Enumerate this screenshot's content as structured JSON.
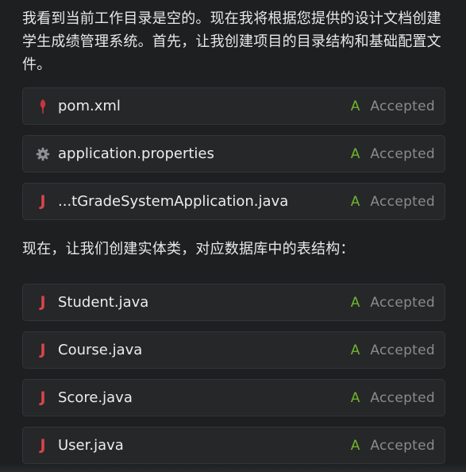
{
  "messages": {
    "intro": "我看到当前工作目录是空的。现在我将根据您提供的设计文档创建学生成绩管理系统。首先，让我创建项目的目录结构和基础配置文件。",
    "entities": "现在，让我们创建实体类，对应数据库中的表结构："
  },
  "config_files": [
    {
      "name": "pom.xml",
      "icon": "maven-feather-icon",
      "status_letter": "A",
      "status": "Accepted"
    },
    {
      "name": "application.properties",
      "icon": "gear-icon",
      "status_letter": "A",
      "status": "Accepted"
    },
    {
      "name": "...tGradeSystemApplication.java",
      "icon": "java-icon",
      "status_letter": "A",
      "status": "Accepted"
    }
  ],
  "entity_files": [
    {
      "name": "Student.java",
      "icon": "java-icon",
      "status_letter": "A",
      "status": "Accepted"
    },
    {
      "name": "Course.java",
      "icon": "java-icon",
      "status_letter": "A",
      "status": "Accepted"
    },
    {
      "name": "Score.java",
      "icon": "java-icon",
      "status_letter": "A",
      "status": "Accepted"
    },
    {
      "name": "User.java",
      "icon": "java-icon",
      "status_letter": "A",
      "status": "Accepted"
    }
  ],
  "colors": {
    "accepted_letter": "#6fb52c",
    "java_icon": "#d8454a",
    "maven_icon": "#c9343f"
  }
}
